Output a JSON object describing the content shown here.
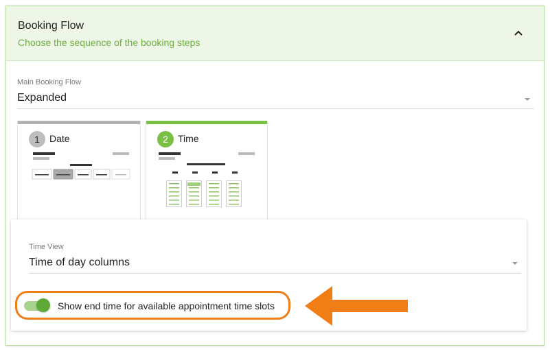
{
  "header": {
    "title": "Booking Flow",
    "subtitle": "Choose the sequence of the booking steps",
    "collapse_icon": "chevron-up-icon"
  },
  "main_flow": {
    "label": "Main Booking Flow",
    "value": "Expanded"
  },
  "steps": [
    {
      "number": "1",
      "label": "Date",
      "active": false
    },
    {
      "number": "2",
      "label": "Time",
      "active": true
    }
  ],
  "time_view": {
    "label": "Time View",
    "value": "Time of day columns"
  },
  "toggle": {
    "label": "Show end time for available appointment time slots",
    "checked": true
  },
  "colors": {
    "accent": "#6cae3e",
    "header_bg": "#eef7e7",
    "highlight": "#f07d16"
  }
}
